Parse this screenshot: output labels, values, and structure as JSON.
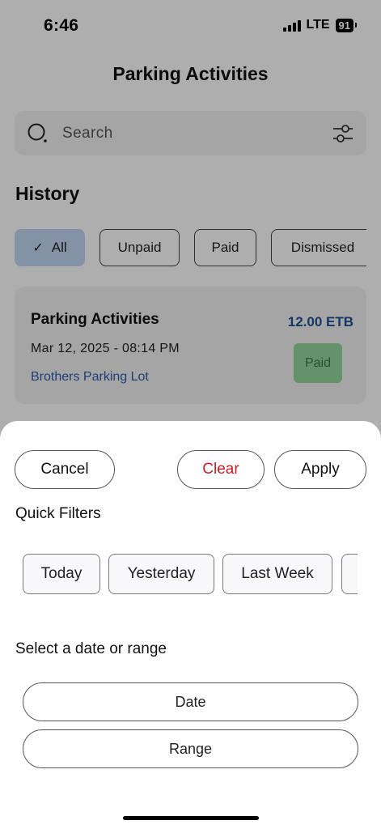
{
  "status_bar": {
    "time": "6:46",
    "network": "LTE",
    "battery": "91"
  },
  "header": {
    "title": "Parking Activities"
  },
  "search": {
    "placeholder": "Search",
    "icon": "search-icon",
    "filter_icon": "sliders-icon"
  },
  "history": {
    "title": "History",
    "filters": [
      {
        "label": "All",
        "selected": true
      },
      {
        "label": "Unpaid",
        "selected": false
      },
      {
        "label": "Paid",
        "selected": false
      },
      {
        "label": "Dismissed",
        "selected": false
      }
    ]
  },
  "activity_card": {
    "title": "Parking Activities",
    "amount": "12.00 ETB",
    "datetime": "Mar 12, 2025 - 08:14 PM",
    "location": "Brothers Parking Lot",
    "status": "Paid"
  },
  "sheet": {
    "cancel_label": "Cancel",
    "clear_label": "Clear",
    "apply_label": "Apply",
    "quick_filters_label": "Quick Filters",
    "quick_filters": [
      "Today",
      "Yesterday",
      "Last Week",
      ""
    ],
    "select_label": "Select a date or range",
    "date_label": "Date",
    "range_label": "Range"
  },
  "colors": {
    "accent_blue": "#1f4f91",
    "selected_chip": "#bdd2ee",
    "clear_red": "#c81e24",
    "paid_green": "#8fd19a"
  }
}
